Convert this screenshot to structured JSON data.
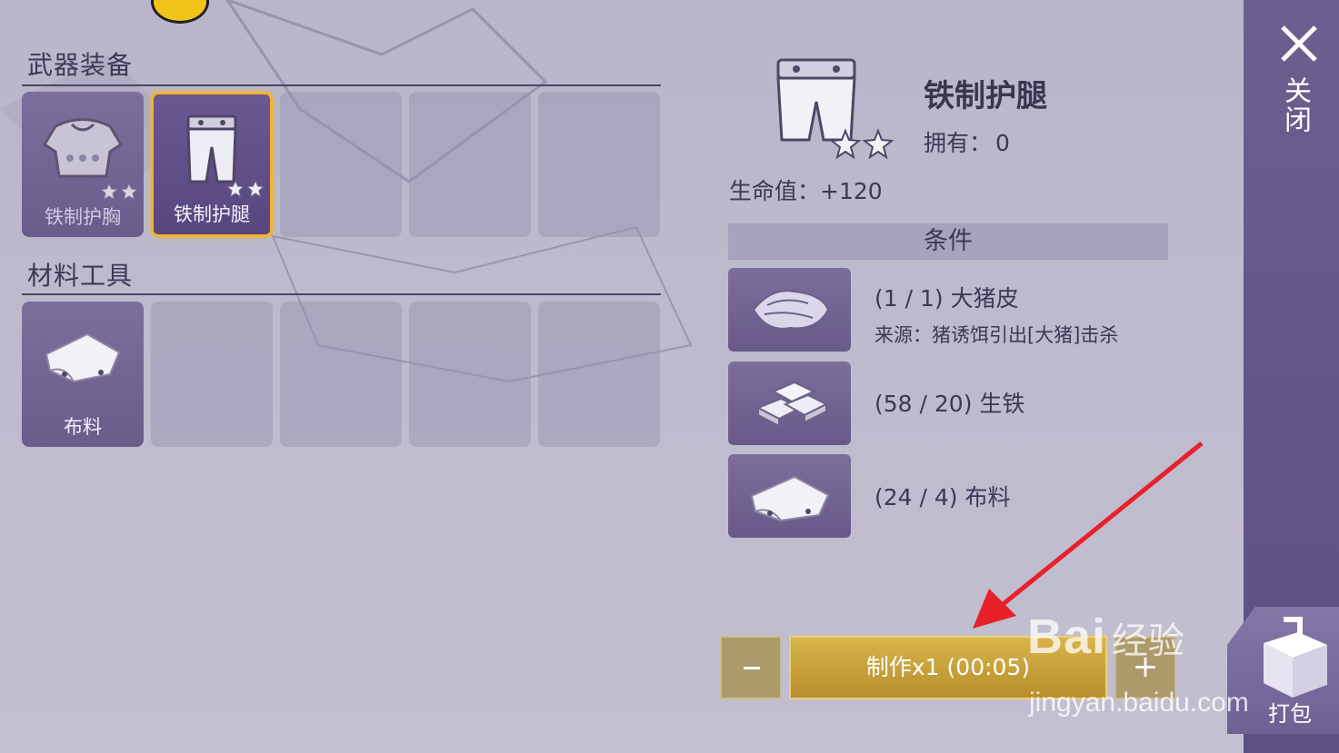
{
  "categories": {
    "weapons": {
      "title": "武器装备",
      "slots": [
        {
          "label": "铁制护胸",
          "icon": "chest-armor-icon",
          "stars": 2,
          "selected": false
        },
        {
          "label": "铁制护腿",
          "icon": "leg-armor-icon",
          "stars": 2,
          "selected": true
        },
        {
          "label": ""
        },
        {
          "label": ""
        },
        {
          "label": ""
        }
      ]
    },
    "materials": {
      "title": "材料工具",
      "slots": [
        {
          "label": "布料",
          "icon": "cloth-icon"
        },
        {
          "label": ""
        },
        {
          "label": ""
        },
        {
          "label": ""
        },
        {
          "label": ""
        }
      ]
    }
  },
  "detail": {
    "name": "铁制护腿",
    "owned_label": "拥有：",
    "owned_count": "0",
    "stat": "生命值：+120",
    "stars": 2,
    "conditions_title": "条件",
    "requirements": [
      {
        "icon": "pig-hide-icon",
        "text": "(1 / 1) 大猪皮",
        "source": "来源：猪诱饵引出[大猪]击杀"
      },
      {
        "icon": "iron-ingot-icon",
        "text": "(58 / 20) 生铁"
      },
      {
        "icon": "cloth-icon",
        "text": "(24 / 4) 布料"
      }
    ]
  },
  "actions": {
    "craft_label": "制作x1 (00:05)",
    "plus": "+",
    "close_label": "关闭",
    "pack_label": "打包"
  },
  "watermark": {
    "main": "Bai",
    "cn": "经验",
    "url": "jingyan.baidu.com"
  },
  "colors": {
    "background": "#bdbacd",
    "panel": "#5d4f82",
    "selected_border": "#f5b326",
    "craft_button": "#c9a23a",
    "arrow": "#e8202a"
  }
}
